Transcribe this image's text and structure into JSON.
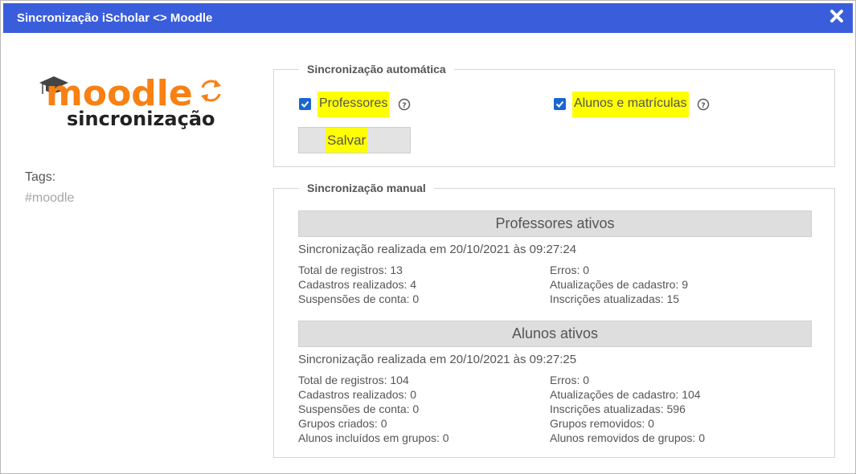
{
  "window": {
    "title": "Sincronização iScholar <> Moodle",
    "close_icon": "close-icon"
  },
  "logo": {
    "word": "moodle",
    "subtitle": "sincronização",
    "accent": "#f98012",
    "icon": "sync-icon"
  },
  "sidebar": {
    "tags_label": "Tags:",
    "tag": "#moodle"
  },
  "auto_sync": {
    "legend": "Sincronização automática",
    "professors_label": "Professores",
    "professors_checked": true,
    "students_label": "Alunos e matrículas",
    "students_checked": true,
    "save_label": "Salvar"
  },
  "manual_sync": {
    "legend": "Sincronização manual",
    "professors": {
      "title": "Professores ativos",
      "sync_text": "Sincronização realizada em 20/10/2021 às 09:27:24",
      "left": [
        "Total de registros: 13",
        "Cadastros realizados: 4",
        "Suspensões de conta: 0"
      ],
      "right": [
        "Erros: 0",
        "Atualizações de cadastro: 9",
        "Inscrições atualizadas: 15"
      ]
    },
    "students": {
      "title": "Alunos ativos",
      "sync_text": "Sincronização realizada em 20/10/2021 às 09:27:25",
      "left": [
        "Total de registros: 104",
        "Cadastros realizados: 0",
        "Suspensões de conta: 0",
        "Grupos criados: 0",
        "Alunos incluídos em grupos: 0"
      ],
      "right": [
        "Erros: 0",
        "Atualizações de cadastro: 104",
        "Inscrições atualizadas: 596",
        "Grupos removidos: 0",
        "Alunos removidos de grupos: 0"
      ]
    }
  },
  "colors": {
    "titlebar": "#3a5ddc",
    "checkbox": "#1966d2",
    "highlight": "#ffff00",
    "tag": "#a6a6a6"
  }
}
